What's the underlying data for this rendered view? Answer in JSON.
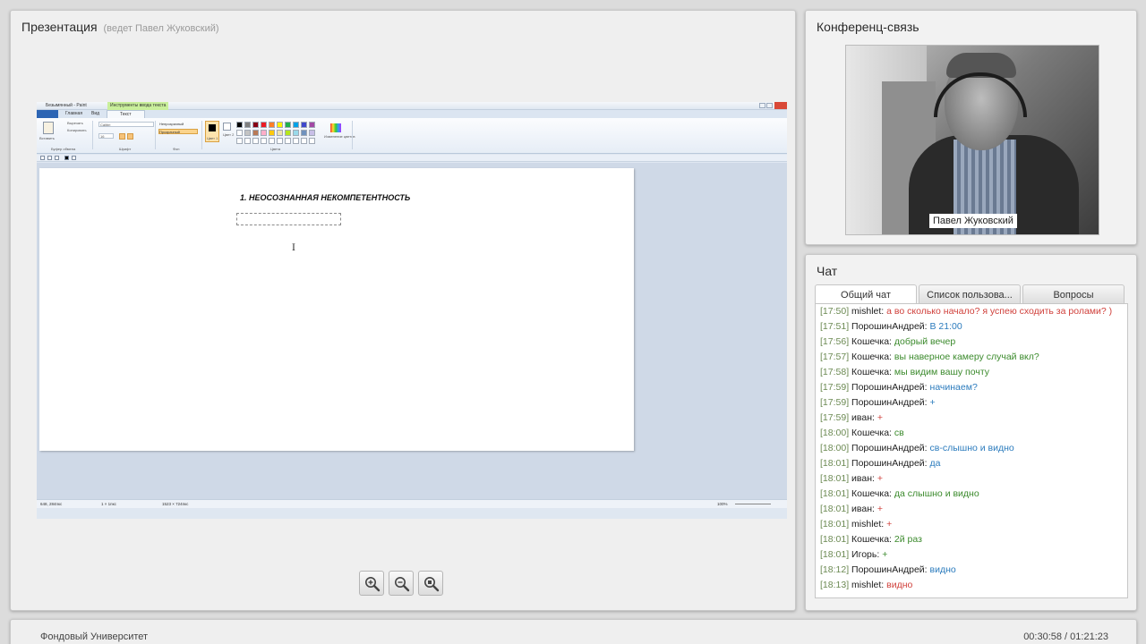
{
  "presentation": {
    "title": "Презентация",
    "presenter": "(ведет Павел Жуковский)",
    "slide": {
      "window_title": "Безымянный - Paint",
      "context_tab": "Инструменты ввода текста",
      "tabs": [
        "Главная",
        "Вид",
        "Текст"
      ],
      "ribbon": {
        "paste": "Вставить",
        "cut": "Вырезать",
        "copy": "Копировать",
        "clipboard_group": "Буфер обмена",
        "font_name": "Calibri",
        "font_size": "16",
        "font_group": "Шрифт",
        "opaque": "Непрозрачный",
        "transparent": "Прозрачный",
        "background_group": "Фон",
        "color1": "Цвет 1",
        "color2": "Цвет 2",
        "colors_group": "Цвета",
        "edit_colors": "Изменение цветов"
      },
      "palette": [
        "#000000",
        "#7f7f7f",
        "#880015",
        "#ed1c24",
        "#ff7f27",
        "#fff200",
        "#22b14c",
        "#00a2e8",
        "#3f48cc",
        "#a349a4",
        "#ffffff",
        "#c3c3c3",
        "#b97a57",
        "#ffaec9",
        "#ffc90e",
        "#efe4b0",
        "#b5e61d",
        "#99d9ea",
        "#7092be",
        "#c8bfe7",
        "#ffffff",
        "#ffffff",
        "#ffffff",
        "#ffffff",
        "#ffffff",
        "#ffffff",
        "#ffffff",
        "#ffffff",
        "#ffffff",
        "#ffffff"
      ],
      "heading": "1. НЕОСОЗНАННАЯ НЕКОМПЕТЕНТНОСТЬ",
      "cursor_glyph": "I",
      "status": {
        "coords": "648, 284пкс",
        "selection": "1 × 1пкс",
        "size": "1523 × 724пкс",
        "zoom": "100%"
      }
    },
    "zoom_controls": [
      "zoom-in",
      "zoom-out",
      "zoom-fit"
    ]
  },
  "conference": {
    "title": "Конференц-связь",
    "speaker_name": "Павел Жуковский"
  },
  "chat": {
    "title": "Чат",
    "tabs": [
      {
        "label": "Общий чат",
        "active": true
      },
      {
        "label": "Список пользова...",
        "active": false
      },
      {
        "label": "Вопросы",
        "active": false
      }
    ],
    "messages": [
      {
        "time": "[17:50]",
        "user": "mishlet:",
        "text": "а во сколько начало? я успею сходить за ролами? )",
        "color": "red"
      },
      {
        "time": "[17:51]",
        "user": "ПорошинАндрей:",
        "text": "В 21:00",
        "color": "blue"
      },
      {
        "time": "[17:56]",
        "user": "Кошечка:",
        "text": "добрый вечер",
        "color": "green"
      },
      {
        "time": "[17:57]",
        "user": "Кошечка:",
        "text": "вы наверное камеру случай вкл?",
        "color": "green"
      },
      {
        "time": "[17:58]",
        "user": "Кошечка:",
        "text": "мы видим вашу почту",
        "color": "green"
      },
      {
        "time": "[17:59]",
        "user": "ПорошинАндрей:",
        "text": "начинаем?",
        "color": "blue"
      },
      {
        "time": "[17:59]",
        "user": "ПорошинАндрей:",
        "text": "+",
        "color": "blue"
      },
      {
        "time": "[17:59]",
        "user": "иван:",
        "text": "+",
        "color": "red"
      },
      {
        "time": "[18:00]",
        "user": "Кошечка:",
        "text": "св",
        "color": "green"
      },
      {
        "time": "[18:00]",
        "user": "ПорошинАндрей:",
        "text": "св-слышно и видно",
        "color": "blue"
      },
      {
        "time": "[18:01]",
        "user": "ПорошинАндрей:",
        "text": "да",
        "color": "blue"
      },
      {
        "time": "[18:01]",
        "user": "иван:",
        "text": "+",
        "color": "red"
      },
      {
        "time": "[18:01]",
        "user": "Кошечка:",
        "text": "да слышно и видно",
        "color": "green"
      },
      {
        "time": "[18:01]",
        "user": "иван:",
        "text": "+",
        "color": "red"
      },
      {
        "time": "[18:01]",
        "user": "mishlet:",
        "text": "+",
        "color": "red"
      },
      {
        "time": "[18:01]",
        "user": "Кошечка:",
        "text": "2й раз",
        "color": "green"
      },
      {
        "time": "[18:01]",
        "user": "Игорь:",
        "text": "+",
        "color": "green"
      },
      {
        "time": "[18:12]",
        "user": "ПорошинАндрей:",
        "text": "видно",
        "color": "blue"
      },
      {
        "time": "[18:13]",
        "user": "mishlet:",
        "text": "видно",
        "color": "red"
      }
    ]
  },
  "footer": {
    "organization": "Фондовый Университет",
    "playback_time": "00:30:58 / 01:21:23"
  }
}
